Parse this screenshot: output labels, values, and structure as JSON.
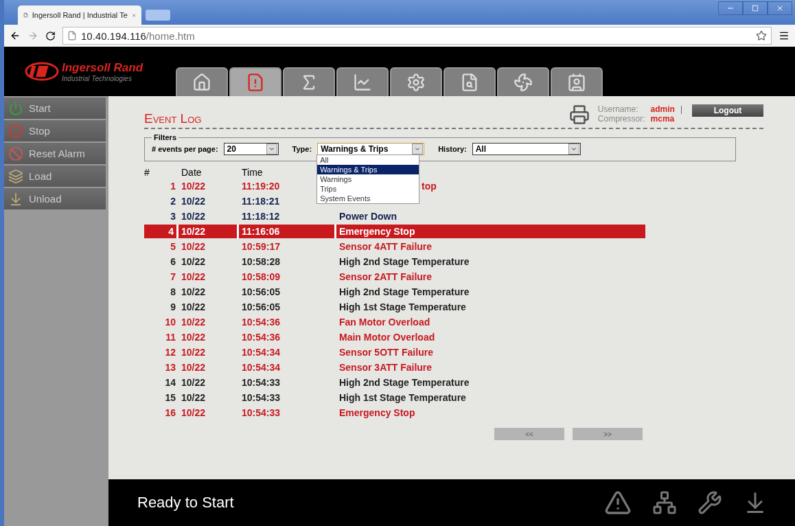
{
  "browser": {
    "tab_title": "Ingersoll Rand | Industrial Te",
    "address_host": "10.40.194.116",
    "address_path": "/home.htm"
  },
  "brand": {
    "name": "Ingersoll Rand",
    "tagline": "Industrial Technologies"
  },
  "nav_tabs": [
    {
      "selected": false
    },
    {
      "selected": true
    },
    {
      "selected": false
    },
    {
      "selected": false
    },
    {
      "selected": false
    },
    {
      "selected": false
    },
    {
      "selected": false
    },
    {
      "selected": false
    }
  ],
  "sidebar": [
    {
      "label": "Start"
    },
    {
      "label": "Stop"
    },
    {
      "label": "Reset Alarm"
    },
    {
      "label": "Load"
    },
    {
      "label": "Unload"
    }
  ],
  "page_title": "Event Log",
  "user": {
    "username_label": "Username:",
    "username": "admin",
    "separator": "|",
    "compressor_label": "Compressor:",
    "compressor": "mcma",
    "logout": "Logout"
  },
  "filters": {
    "legend": "Filters",
    "per_page_label": "# events per page:",
    "per_page": "20",
    "type_label": "Type:",
    "type": "Warnings & Trips",
    "history_label": "History:",
    "history": "All",
    "type_options": [
      {
        "label": "All",
        "selected": false
      },
      {
        "label": "Warnings & Trips",
        "selected": true
      },
      {
        "label": "Warnings",
        "selected": false
      },
      {
        "label": "Trips",
        "selected": false
      },
      {
        "label": "System Events",
        "selected": false
      }
    ]
  },
  "table": {
    "columns": [
      "#",
      "Date",
      "Time"
    ],
    "rows": [
      {
        "n": "1",
        "date": "10/22",
        "time": "11:19:20",
        "event": "top",
        "kind": "trip",
        "covered": true,
        "selected": false
      },
      {
        "n": "2",
        "date": "10/22",
        "time": "11:18:21",
        "kind": "system",
        "selected": false
      },
      {
        "n": "3",
        "date": "10/22",
        "time": "11:18:12",
        "event": "Power Down",
        "kind": "system",
        "selected": false
      },
      {
        "n": "4",
        "date": "10/22",
        "time": "11:16:06",
        "event": "Emergency Stop",
        "kind": "trip",
        "selected": true
      },
      {
        "n": "5",
        "date": "10/22",
        "time": "10:59:17",
        "event": "Sensor 4ATT Failure",
        "kind": "trip",
        "selected": false
      },
      {
        "n": "6",
        "date": "10/22",
        "time": "10:58:28",
        "event": "High 2nd Stage Temperature",
        "kind": "warning",
        "selected": false
      },
      {
        "n": "7",
        "date": "10/22",
        "time": "10:58:09",
        "event": "Sensor 2ATT Failure",
        "kind": "trip",
        "selected": false
      },
      {
        "n": "8",
        "date": "10/22",
        "time": "10:56:05",
        "event": "High 2nd Stage Temperature",
        "kind": "warning",
        "selected": false
      },
      {
        "n": "9",
        "date": "10/22",
        "time": "10:56:05",
        "event": "High 1st Stage Temperature",
        "kind": "warning",
        "selected": false
      },
      {
        "n": "10",
        "date": "10/22",
        "time": "10:54:36",
        "event": "Fan Motor Overload",
        "kind": "trip",
        "selected": false
      },
      {
        "n": "11",
        "date": "10/22",
        "time": "10:54:36",
        "event": "Main Motor Overload",
        "kind": "trip",
        "selected": false
      },
      {
        "n": "12",
        "date": "10/22",
        "time": "10:54:34",
        "event": "Sensor 5OTT Failure",
        "kind": "trip",
        "selected": false
      },
      {
        "n": "13",
        "date": "10/22",
        "time": "10:54:34",
        "event": "Sensor 3ATT Failure",
        "kind": "trip",
        "selected": false
      },
      {
        "n": "14",
        "date": "10/22",
        "time": "10:54:33",
        "event": "High 2nd Stage Temperature",
        "kind": "warning",
        "selected": false
      },
      {
        "n": "15",
        "date": "10/22",
        "time": "10:54:33",
        "event": "High 1st Stage Temperature",
        "kind": "warning",
        "selected": false
      },
      {
        "n": "16",
        "date": "10/22",
        "time": "10:54:33",
        "event": "Emergency Stop",
        "kind": "trip",
        "selected": false
      }
    ]
  },
  "pager": {
    "prev": "<<",
    "next": ">>"
  },
  "status": "Ready to Start"
}
